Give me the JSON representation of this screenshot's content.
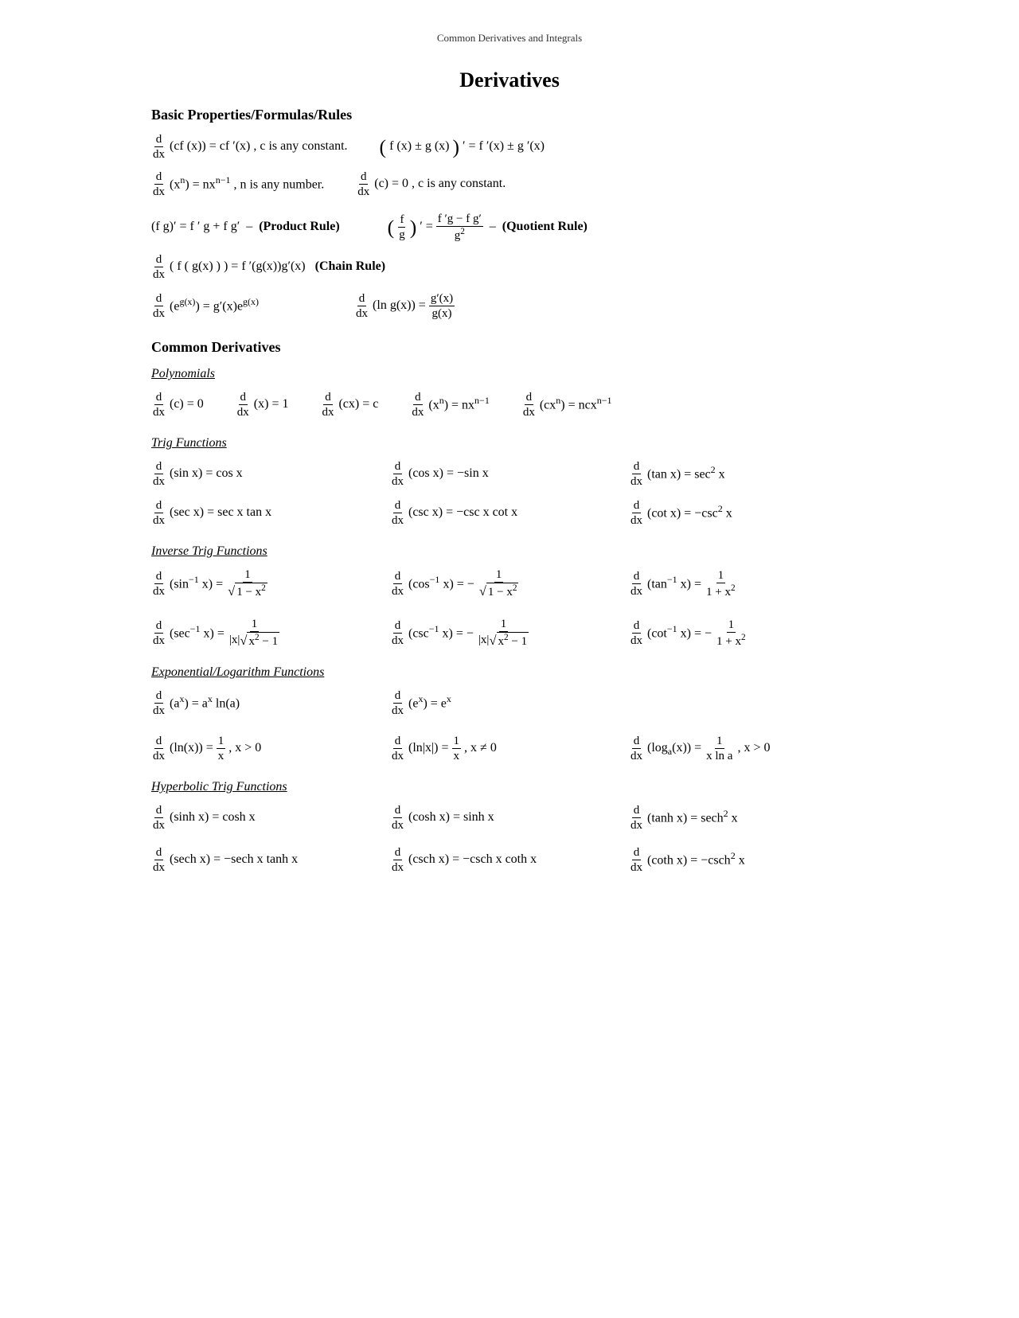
{
  "header": {
    "title": "Common Derivatives and Integrals"
  },
  "page": {
    "main_title": "Derivatives",
    "sections": {
      "basic": {
        "title": "Basic Properties/Formulas/Rules"
      },
      "common": {
        "title": "Common Derivatives"
      },
      "polynomials": {
        "title": "Polynomials"
      },
      "trig": {
        "title": "Trig Functions"
      },
      "inverse_trig": {
        "title": "Inverse Trig Functions"
      },
      "exp_log": {
        "title": "Exponential/Logarithm Functions"
      },
      "hyp_trig": {
        "title": "Hyperbolic Trig Functions"
      }
    }
  }
}
